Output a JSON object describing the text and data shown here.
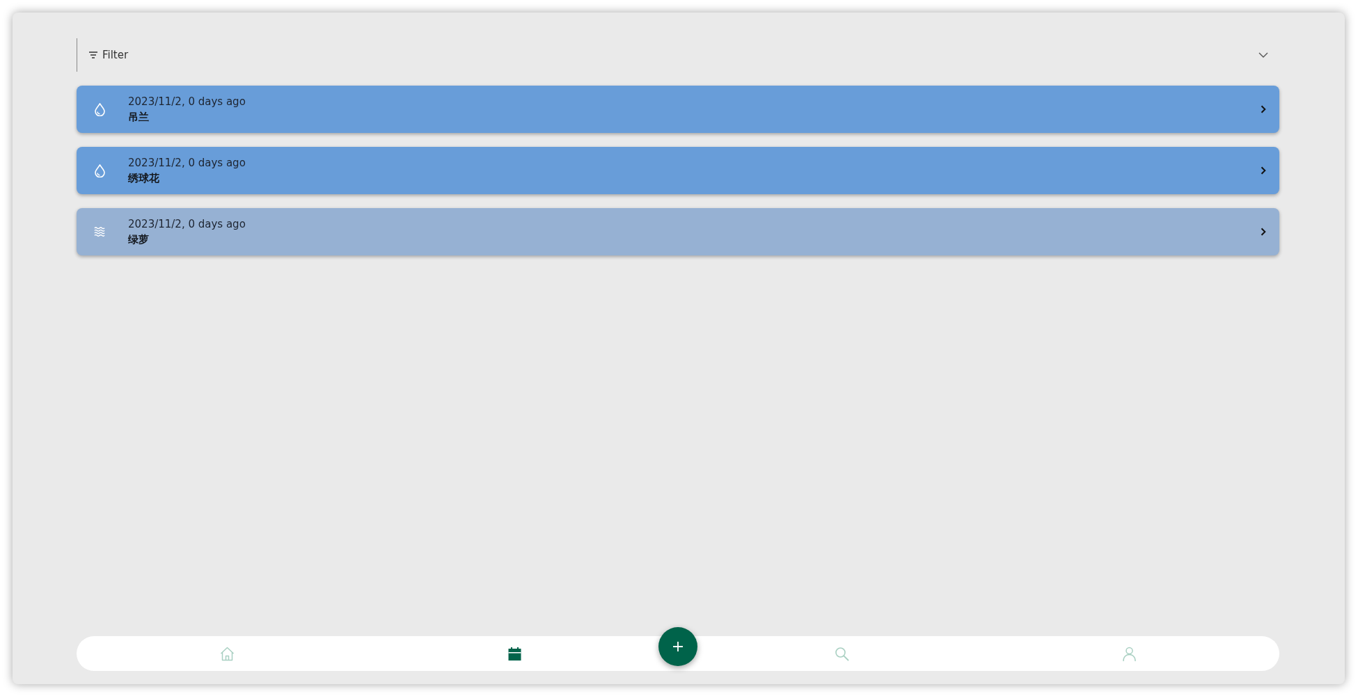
{
  "filter": {
    "label": "Filter",
    "expanded": false
  },
  "records": [
    {
      "kind": "water",
      "date": "2023/11/2, 0 days ago",
      "name": "吊兰"
    },
    {
      "kind": "water",
      "date": "2023/11/2, 0 days ago",
      "name": "绣球花"
    },
    {
      "kind": "mist",
      "date": "2023/11/2, 0 days ago",
      "name": "绿萝"
    }
  ],
  "nav": [
    {
      "kind": "home",
      "selected": false
    },
    {
      "kind": "calendar",
      "selected": true
    },
    {
      "kind": "search",
      "selected": false
    },
    {
      "kind": "profile",
      "selected": false
    }
  ]
}
